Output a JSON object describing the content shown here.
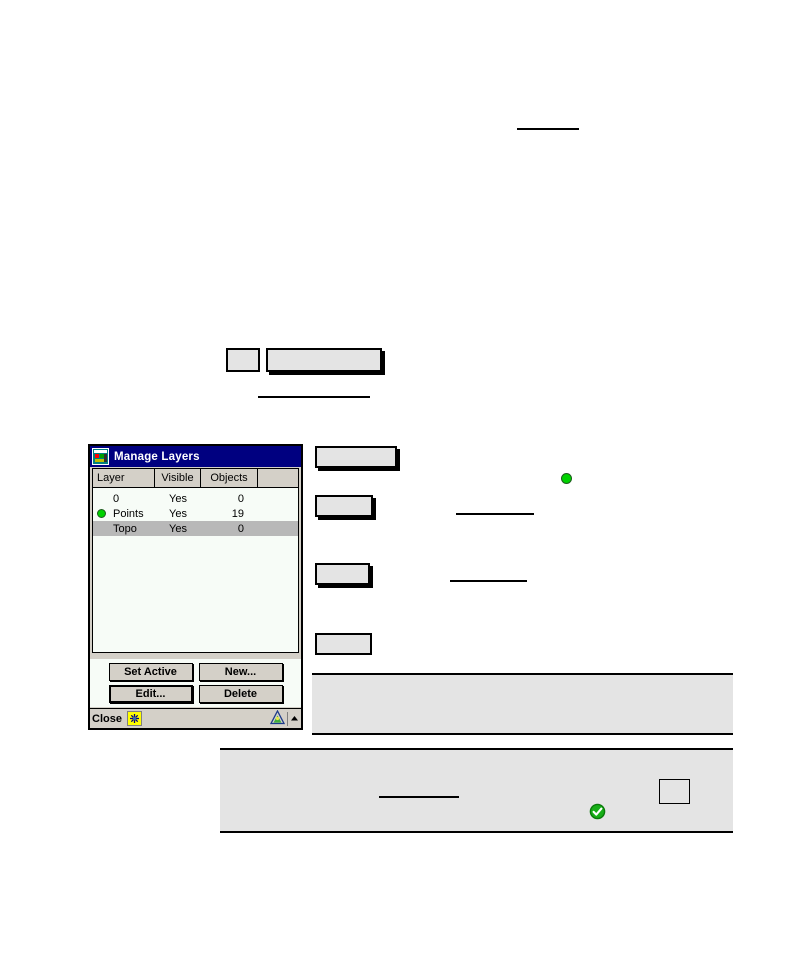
{
  "dialog": {
    "title": "Manage Layers",
    "title_icon": "map-layers-icon",
    "columns": [
      "Layer",
      "Visible",
      "Objects",
      ""
    ],
    "rows": [
      {
        "active": false,
        "layer": "0",
        "visible": "Yes",
        "objects": "0",
        "selected": false
      },
      {
        "active": true,
        "layer": "Points",
        "visible": "Yes",
        "objects": "19",
        "selected": false
      },
      {
        "active": false,
        "layer": "Topo",
        "visible": "Yes",
        "objects": "0",
        "selected": true
      }
    ],
    "buttons": {
      "set_active": "Set Active",
      "new": "New...",
      "edit": "Edit...",
      "delete": "Delete"
    },
    "statusbar": {
      "close_label": "Close",
      "keyboard_icon": "input-panel-icon",
      "app_icon": "survey-triangle-icon",
      "expand_icon": "chevron-up-icon"
    }
  },
  "colors": {
    "titlebar": "#000080",
    "title_text": "#ffffff",
    "dialog_face": "#d4d0c8",
    "list_background": "#f7fcf7",
    "row_selected": "#b8b8b8",
    "active_dot": "#00d200",
    "placeholder_fill": "#e4e4e4",
    "outline": "#000000",
    "status_keyboard": "#ffff00"
  },
  "placeholders": {
    "top_rule": {
      "label": "underline-rule"
    },
    "mid_small_box": {
      "label": "small-button-placeholder"
    },
    "mid_wide_box": {
      "label": "wide-field-placeholder"
    },
    "mid_rule": {
      "label": "underline-rule"
    },
    "side_buttons": [
      {
        "label": "button-placeholder-1"
      },
      {
        "label": "button-placeholder-2"
      },
      {
        "label": "button-placeholder-3"
      },
      {
        "label": "button-placeholder-4"
      }
    ],
    "side_rules": [
      {
        "label": "underline-rule"
      },
      {
        "label": "underline-rule"
      }
    ],
    "side_dot": {
      "label": "active-layer-dot"
    },
    "note_panels": [
      {
        "label": "note-panel-upper"
      },
      {
        "label": "note-panel-lower"
      }
    ],
    "note_rule": {
      "label": "underline-rule"
    },
    "note_check": {
      "label": "green-check-icon"
    },
    "note_square": {
      "label": "empty-square-placeholder"
    }
  }
}
